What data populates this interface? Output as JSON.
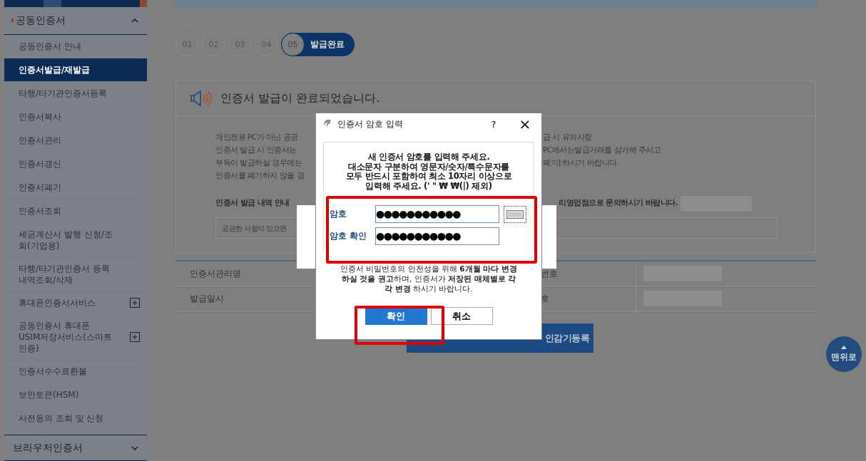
{
  "sidebar": {
    "section": {
      "label": "공동인증서",
      "expanded": true
    },
    "items": [
      {
        "label": "공동인증서 안내",
        "selected": false,
        "expandable": false
      },
      {
        "label": "인증서발급/재발급",
        "selected": true,
        "expandable": false
      },
      {
        "label": "타행/타기관인증서등록",
        "selected": false,
        "expandable": false
      },
      {
        "label": "인증서복사",
        "selected": false,
        "expandable": false
      },
      {
        "label": "인증서관리",
        "selected": false,
        "expandable": false
      },
      {
        "label": "인증서갱신",
        "selected": false,
        "expandable": false
      },
      {
        "label": "인증서폐기",
        "selected": false,
        "expandable": false
      },
      {
        "label": "인증서조회",
        "selected": false,
        "expandable": false
      },
      {
        "label": "세금계산서 발행 신청/조회(기업용)",
        "selected": false,
        "expandable": false
      },
      {
        "label": "타행/타기관인증서 등록내역조회/삭제",
        "selected": false,
        "expandable": false
      },
      {
        "label": "휴대폰인증서서비스",
        "selected": false,
        "expandable": true
      },
      {
        "label": "공동인증서 휴대폰 USIM저장서비스(스마트인증)",
        "selected": false,
        "expandable": true
      },
      {
        "label": "인증서수수료환불",
        "selected": false,
        "expandable": false
      },
      {
        "label": "보안토큰(HSM)",
        "selected": false,
        "expandable": false
      },
      {
        "label": "사전동의 조회 및 신청",
        "selected": false,
        "expandable": false
      }
    ],
    "footer_section": {
      "label": "브라우저인증서",
      "expanded": false
    }
  },
  "steps": [
    {
      "label": "01",
      "selected": false
    },
    {
      "label": "02",
      "selected": false
    },
    {
      "label": "03",
      "selected": false
    },
    {
      "label": "04",
      "selected": false
    },
    {
      "label": "05",
      "selected": true,
      "caption": "발급완료"
    }
  ],
  "notice": {
    "title": "인증서 발급이 완료되었습니다.",
    "lines": [
      {
        "left": "개인전용 PC가 아닌 공공",
        "right": "급 시 유의사항"
      },
      {
        "left": "인증서 발급 시 인증서는",
        "right": "PC에서는발급거래를 삼가해 주시고"
      },
      {
        "left": "부득이 발급하실 경우에는",
        "right": "폐기] 하시기 바랍니다."
      },
      {
        "left": "인증서를 폐기하지 않을 경"
      }
    ],
    "inquiry": {
      "left": "인증서 발급 내역 안내",
      "right": "리영업점으로 문의하시기 바랍니다."
    },
    "question_field": {
      "placeholder": "궁금한 사항이 있으면"
    }
  },
  "table": {
    "rows": [
      {
        "label": "인증서관리명",
        "column_3": "번호"
      },
      {
        "label": "발급일시",
        "column_3": "호"
      }
    ]
  },
  "register_button": "인감기등록",
  "top_button": "맨위로",
  "dialog": {
    "title": "인증서 암호 입력",
    "help": "?",
    "close": "×",
    "instructions": [
      "새 인증서 암호를 입력해 주세요.",
      "대소문자 구분하여 영문자/숫자/특수문자를",
      "모두 반드시 포함하여 최소 10자리 이상으로",
      "입력해 주세요. (' \" ₩ ₩(|) 제외)"
    ],
    "fields": [
      {
        "label": "암호",
        "value": "●●●●●●●●●●●",
        "keyboard": true
      },
      {
        "label": "암호 확인",
        "value": "●●●●●●●●●●●",
        "keyboard": false
      }
    ],
    "note": "인증서 비밀번호의 안전성을 위해 **6개월 마다 변경하실 것을 권고**하며, 인증서가 **저장된 매체별로 각각 변경** 하시기 바랍니다.",
    "buttons": [
      {
        "label": "확인",
        "kind": "primary"
      },
      {
        "label": "취소",
        "kind": "secondary"
      }
    ]
  }
}
